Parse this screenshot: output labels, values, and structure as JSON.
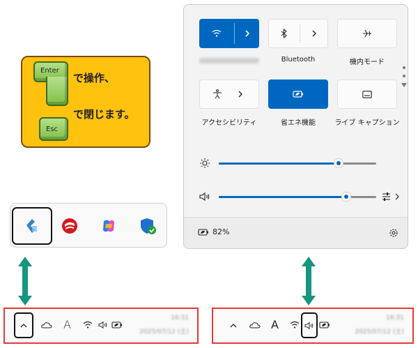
{
  "hint": {
    "enter_key": "Enter",
    "esc_key": "Esc",
    "line1": "で操作、",
    "line2": "で閉じます。"
  },
  "overflow": {
    "icons": [
      "copilot-lens-icon",
      "trend-micro-icon",
      "copilot-icon",
      "defender-shield-icon"
    ]
  },
  "quick_settings": {
    "tiles": [
      {
        "id": "wifi",
        "label": "",
        "state": "on",
        "icon": "wifi-icon",
        "label_blurred": true
      },
      {
        "id": "bluetooth",
        "label": "Bluetooth",
        "state": "off",
        "icon": "bluetooth-icon"
      },
      {
        "id": "airplane",
        "label": "機内モード",
        "state": "off",
        "icon": "airplane-icon"
      },
      {
        "id": "accessibility",
        "label": "アクセシビリティ",
        "state": "off",
        "icon": "accessibility-icon"
      },
      {
        "id": "energy-saver",
        "label": "省エネ機能",
        "state": "on",
        "icon": "battery-leaf-icon"
      },
      {
        "id": "live-captions",
        "label": "ライブ キャプション",
        "state": "off",
        "icon": "captions-icon"
      }
    ],
    "brightness": {
      "value": 0.76
    },
    "volume": {
      "value": 0.81
    },
    "battery": {
      "percent": "82%"
    }
  },
  "taskbar": {
    "time": "16:31",
    "date": "2025/07/12 (土)",
    "colors": {
      "highlight": "#e53935",
      "accent": "#0067c0",
      "arrow": "#16967f"
    }
  }
}
